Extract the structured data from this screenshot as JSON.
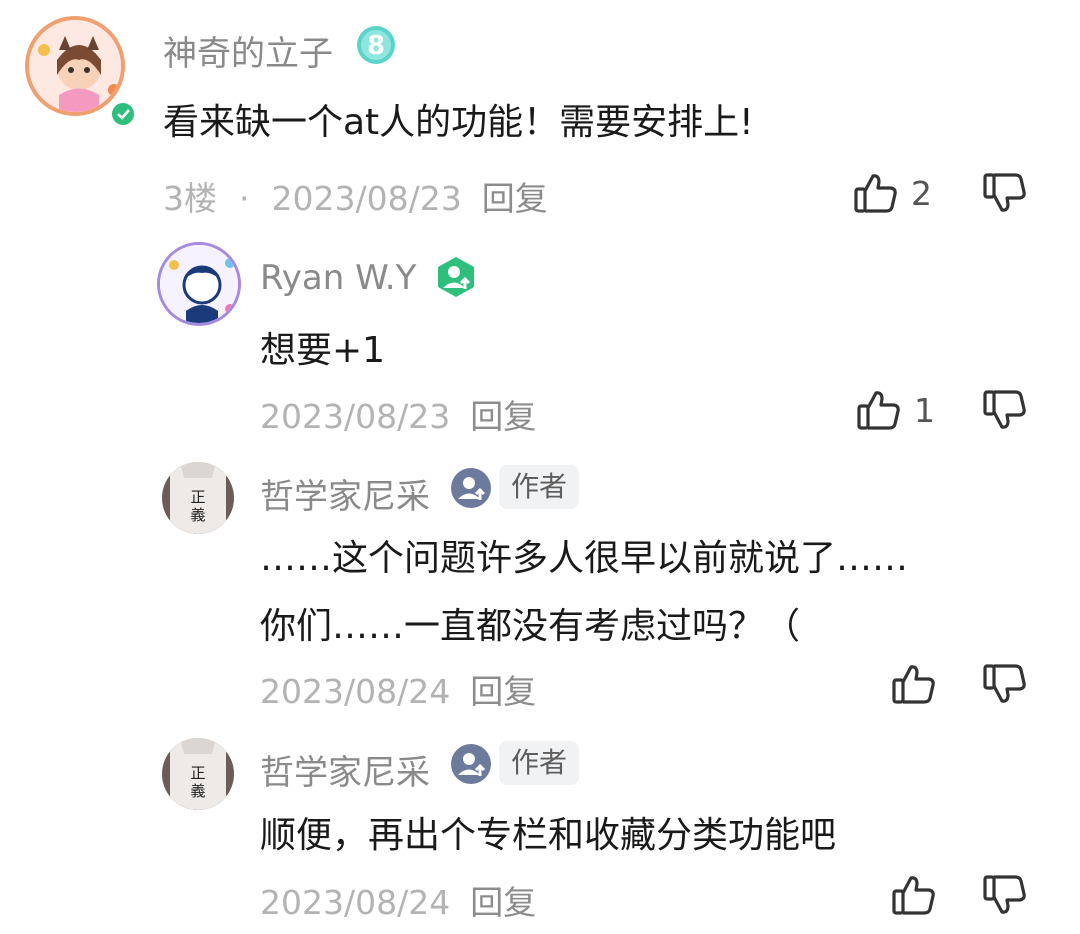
{
  "comments": [
    {
      "username": "神奇的立子",
      "content_lines": [
        "看来缺一个at人的功能！需要安排上!"
      ],
      "floor": "3楼",
      "separator": "·",
      "date": "2023/08/23",
      "reply_label": "回复",
      "like_count": "2",
      "level_badge": "8"
    },
    {
      "username": "Ryan W.Y",
      "content_lines": [
        "想要+1"
      ],
      "date": "2023/08/23",
      "reply_label": "回复",
      "like_count": "1"
    },
    {
      "username": "哲学家尼采",
      "author_tag": "作者",
      "content_lines": [
        "……这个问题许多人很早以前就说了……",
        "你们……一直都没有考虑过吗？（"
      ],
      "date": "2023/08/24",
      "reply_label": "回复",
      "like_count": ""
    },
    {
      "username": "哲学家尼采",
      "author_tag": "作者",
      "content_lines": [
        "顺便，再出个专栏和收藏分类功能吧"
      ],
      "date": "2023/08/24",
      "reply_label": "回复",
      "like_count": ""
    }
  ],
  "colors": {
    "username": "#8a8a8a",
    "meta": "#b3b3b3",
    "level_badge": "#5bd3c9",
    "verified_green": "#2fbf7c",
    "badge_slate": "#6c7a9c"
  }
}
